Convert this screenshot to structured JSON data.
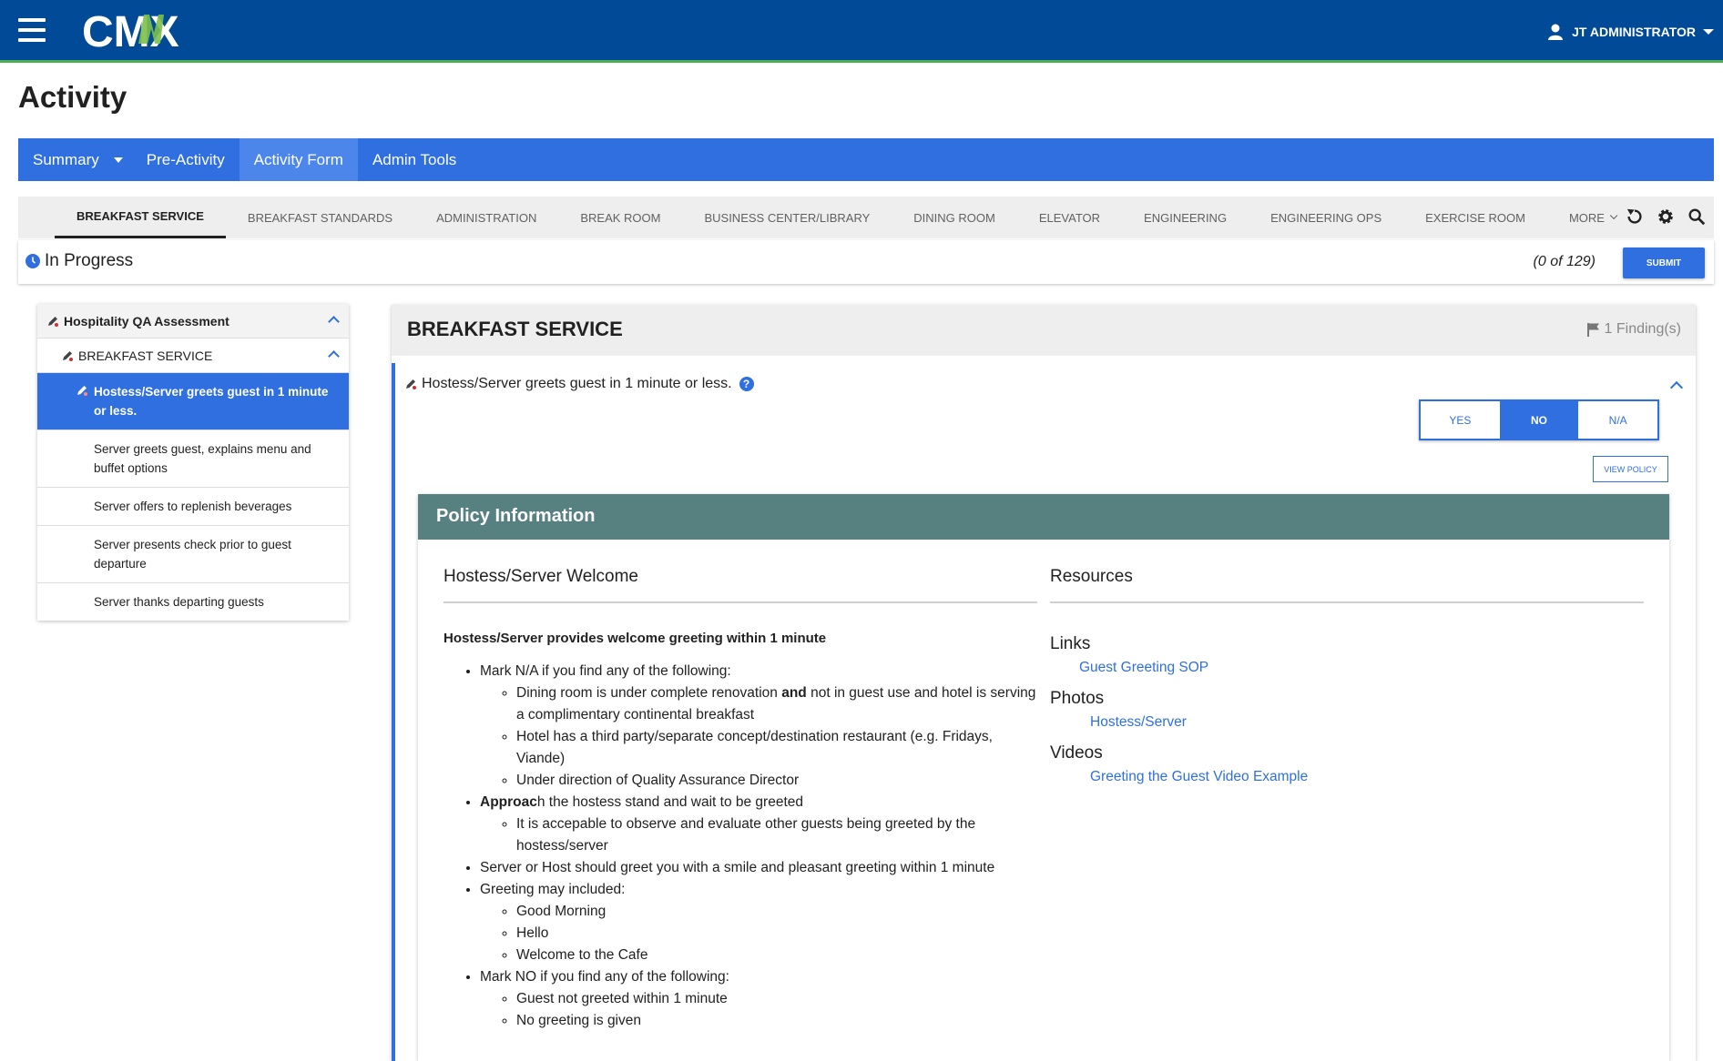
{
  "header": {
    "logo_text": "CMX",
    "user_name": "JT ADMINISTRATOR"
  },
  "page": {
    "title": "Activity"
  },
  "nav": {
    "items": [
      {
        "label": "Summary"
      },
      {
        "label": "Pre-Activity"
      },
      {
        "label": "Activity Form"
      },
      {
        "label": "Admin Tools"
      }
    ]
  },
  "tabs": [
    "BREAKFAST SERVICE",
    "BREAKFAST STANDARDS",
    "ADMINISTRATION",
    "BREAK ROOM",
    "BUSINESS CENTER/LIBRARY",
    "DINING ROOM",
    "ELEVATOR",
    "ENGINEERING",
    "ENGINEERING OPS",
    "EXERCISE ROOM",
    "MORE"
  ],
  "status": {
    "label": "In Progress",
    "count": "(0 of 129)",
    "submit": "SUBMIT"
  },
  "tree": {
    "root": "Hospitality QA Assessment",
    "section": "BREAKFAST SERVICE",
    "items": [
      "Hostess/Server greets guest in 1 minute or less.",
      "Server greets guest, explains menu and buffet options",
      "Server offers to replenish beverages",
      "Server presents check prior to guest departure",
      "Server thanks departing guests"
    ]
  },
  "main": {
    "title": "BREAKFAST SERVICE",
    "findings": "1 Finding(s)",
    "question": "Hostess/Server greets guest in 1 minute or less.",
    "answers": [
      "YES",
      "NO",
      "N/A"
    ],
    "selected_answer": "NO",
    "view_policy": "VIEW POLICY"
  },
  "policy": {
    "header": "Policy Information",
    "left_title": "Hostess/Server Welcome",
    "lead": "Hostess/Server provides welcome greeting within 1 minute",
    "b1": "Mark N/A if you find any of the following:",
    "b1_s1_a": "Dining room is under complete renovation ",
    "b1_s1_b": "and",
    "b1_s1_c": " not in guest use and hotel is serving a complimentary continental breakfast",
    "b1_s2": "Hotel has a third party/separate concept/destination restaurant (e.g. Fridays, Viande)",
    "b1_s3": "Under direction of Quality Assurance Director",
    "b2_a": "Approac",
    "b2_b": "h the hostess stand and wait to be greeted",
    "b2_s1": "It is accepable to observe and evaluate other guests being greeted by the hostess/server",
    "b3": "Server or Host should greet you with a smile and pleasant greeting within 1 minute",
    "b4": "Greeting may included:",
    "b4_s1": "Good Morning",
    "b4_s2": "Hello",
    "b4_s3": "Welcome to the Cafe",
    "b5": "Mark NO if you find any of the following:",
    "b5_s1": "Guest not greeted within 1 minute",
    "b5_s2": "No greeting is given",
    "right_title": "Resources",
    "links_label": "Links",
    "link1": "Guest Greeting SOP",
    "photos_label": "Photos",
    "photo1": "Hostess/Server",
    "videos_label": "Videos",
    "video1": "Greeting the Guest Video Example"
  },
  "colors": {
    "header_bg": "#004a97",
    "accent": "#2f6fe0",
    "policy_header": "#578181",
    "header_underline": "#4caf50"
  }
}
